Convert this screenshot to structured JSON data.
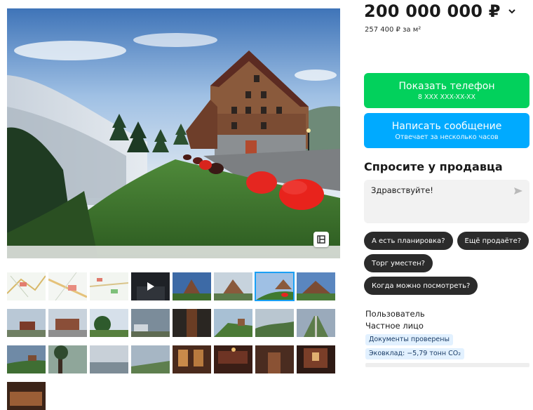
{
  "listing": {
    "price": "200 000 000 ₽",
    "price_per_m2": "257 400 ₽ за м²",
    "photo_count_visible": 24,
    "active_thumb_index": 6
  },
  "actions": {
    "show_phone_label": "Показать телефон",
    "phone_masked": "8 XXX XXX-XX-XX",
    "write_message_label": "Написать сообщение",
    "response_time": "Отвечает за несколько часов"
  },
  "ask_seller": {
    "title": "Спросите у продавца",
    "message_value": "Здравствуйте!",
    "quick_questions": [
      "А есть планировка?",
      "Ещё продаёте?",
      "Торг уместен?",
      "Когда можно посмотреть?"
    ]
  },
  "seller": {
    "name": "Пользователь",
    "type": "Частное лицо",
    "badges": [
      "Документы проверены",
      "Эковклад: −5,79 тонн CO₂"
    ]
  },
  "colors": {
    "green_button": "#02d15c",
    "blue_button": "#00aaff",
    "chip_bg": "#2b2b2b",
    "badge_bg": "#e2f1ff",
    "active_thumb_outline": "#1aa0f4"
  },
  "icons": {
    "price_dropdown": "chevron-down-icon",
    "send": "send-arrow-icon",
    "fullscreen": "expand-icon",
    "video": "play-icon"
  }
}
